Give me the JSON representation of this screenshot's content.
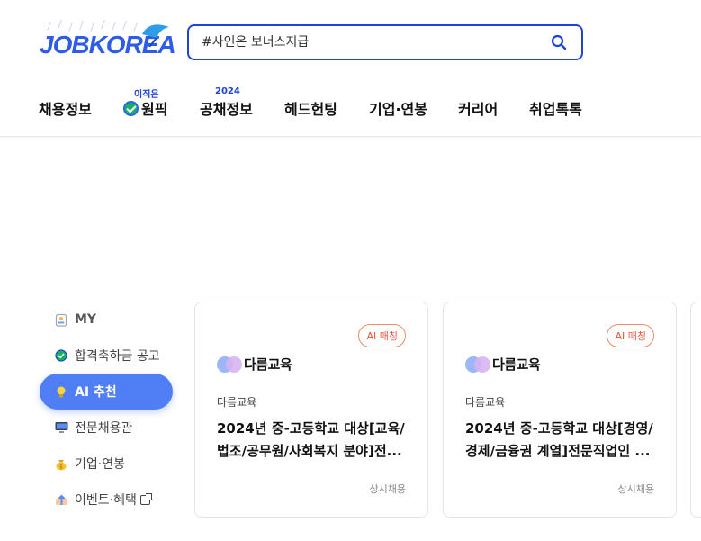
{
  "header": {
    "logo_text": "JOBKOREA",
    "search_placeholder": "#사인온 보너스지급"
  },
  "nav": {
    "items": [
      {
        "label": "채용정보",
        "tag": ""
      },
      {
        "label": "원픽",
        "tag": "이직은"
      },
      {
        "label": "공채정보",
        "tag": "2024"
      },
      {
        "label": "헤드헌팅",
        "tag": ""
      },
      {
        "label": "기업·연봉",
        "tag": ""
      },
      {
        "label": "커리어",
        "tag": ""
      },
      {
        "label": "취업톡톡",
        "tag": ""
      }
    ]
  },
  "sidebar": {
    "items": [
      {
        "label": "MY",
        "icon": "id-badge-icon"
      },
      {
        "label": "합격축하금 공고",
        "icon": "check-circle-icon"
      },
      {
        "label": "AI 추천",
        "icon": "lightbulb-icon",
        "active": true
      },
      {
        "label": "전문채용관",
        "icon": "monitor-icon"
      },
      {
        "label": "기업·연봉",
        "icon": "money-bag-icon"
      },
      {
        "label": "이벤트·혜택",
        "icon": "gift-icon"
      }
    ]
  },
  "cards": [
    {
      "badge": "AI 매칭",
      "logo_name": "다름교육",
      "company": "다름교육",
      "title": "2024년 중-고등학교 대상[교육/법조/공무원/사회복지 분야]전...",
      "status": "상시채용"
    },
    {
      "badge": "AI 매칭",
      "logo_name": "다름교육",
      "company": "다름교육",
      "title": "2024년 중-고등학교 대상[경영/경제/금융권 계열]전문직업인 ...",
      "status": "상시채용"
    }
  ],
  "colors": {
    "brand": "#2f5ce6",
    "search_border": "#1f44d6",
    "active_tab": "#4f7ef5",
    "badge": "#e8573a"
  }
}
